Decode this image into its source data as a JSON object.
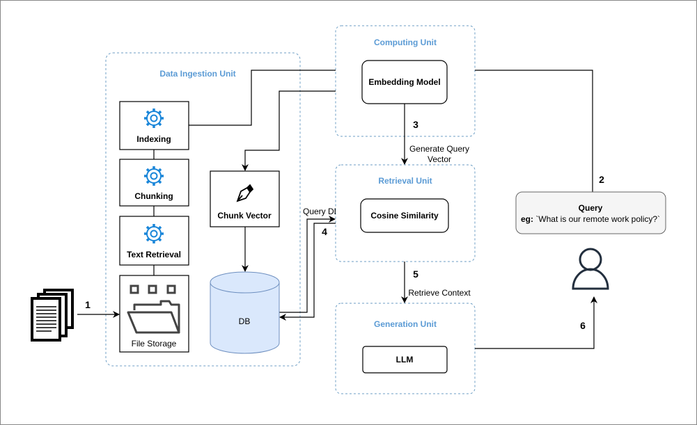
{
  "units": {
    "data_ingestion": "Data Ingestion Unit",
    "computing": "Computing Unit",
    "retrieval": "Retrieval Unit",
    "generation": "Generation Unit"
  },
  "nodes": {
    "indexing": "Indexing",
    "chunking": "Chunking",
    "text_retrieval": "Text Retrieval",
    "file_storage": "File Storage",
    "chunk_vector": "Chunk Vector",
    "db": "DB",
    "embedding_model": "Embedding Model",
    "cosine_similarity": "Cosine Similarity",
    "llm": "LLM",
    "query_title": "Query",
    "query_eg_label": "eg:",
    "query_example": "`What is our remote work policy?`"
  },
  "edges": {
    "step1": "1",
    "step2": "2",
    "step3": "3",
    "step3_label_line1": "Generate Query",
    "step3_label_line2": "Vector",
    "step4": "4",
    "step4_label": "Query DB",
    "step5": "5",
    "step5_label": "Retrieve Context",
    "step6": "6"
  },
  "colors": {
    "unit_border": "#6c9ec4",
    "unit_label": "#5b9bd5",
    "gear": "#1a86d9",
    "db_fill": "#dae8fc"
  }
}
